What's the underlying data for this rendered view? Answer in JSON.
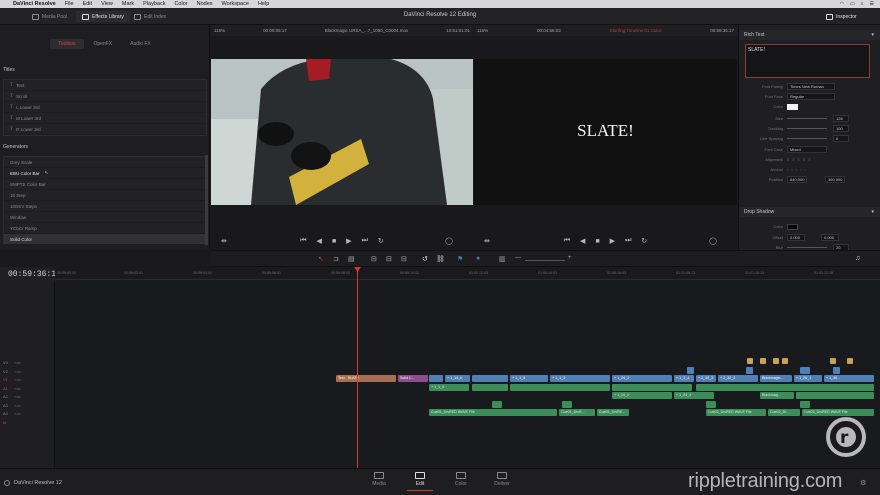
{
  "menubar": {
    "app": "DaVinci Resolve",
    "items": [
      "File",
      "Edit",
      "View",
      "Mark",
      "Playback",
      "Color",
      "Nodes",
      "Workspace",
      "Help"
    ]
  },
  "titlebar": {
    "media_pool": "Media Pool",
    "effects_library": "Effects Library",
    "edit_index": "Edit Index",
    "project": "DaVinci Resolve 12 Editing",
    "inspector": "Inspector"
  },
  "leftpanel": {
    "tabs": [
      "Toolbox",
      "OpenFX",
      "Audio FX"
    ],
    "titles_header": "Titles",
    "titles": [
      "Text",
      "Scroll",
      "L Lower 3rd",
      "M Lower 3rd",
      "R Lower 3rd"
    ],
    "generators_header": "Generators",
    "generators": [
      "Grey Scale",
      "EBU Color Bar",
      "SMPTE Color Bar",
      "10 Step",
      "100mV Steps",
      "Window",
      "YCbCr Ramp",
      "Solid Color"
    ]
  },
  "viewerL": {
    "zoom": "116%",
    "tc_in": "00:00:05:17",
    "clip": "Blackmagic URSA_...7_1050_C0004.mov",
    "tc_out": "10:51:01:01"
  },
  "viewerR": {
    "zoom": "116%",
    "tc_in": "00:04:56:03",
    "timeline": "Starting Timeline 01 Color",
    "tc_out": "00:59:36:17",
    "slate": "SLATE!"
  },
  "inspector": {
    "section1": "Rich Text",
    "text_value": "SLATE!",
    "font_family_label": "Font Family",
    "font_family": "Times New Roman",
    "font_face_label": "Font Face",
    "font_face": "Regular",
    "color_label": "Color",
    "size_label": "Size",
    "size": "128",
    "tracking_label": "Tracking",
    "tracking": "100",
    "line_spacing_label": "Line Spacing",
    "line_spacing": "0",
    "font_case_label": "Font Case",
    "font_case": "Mixed",
    "alignment_label": "Alignment",
    "anchor_label": "Anchor",
    "position_label": "Position",
    "pos_x": "640.000",
    "pos_y": "360.000",
    "section2": "Drop Shadow",
    "ds_color_label": "Color",
    "ds_offset_label": "Offset",
    "ds_x": "0.000",
    "ds_y": "0.000",
    "ds_blur_label": "Blur",
    "ds_blur": "20"
  },
  "timeline": {
    "timecode": "00:59:36:17",
    "ruler": [
      "00:59:00:00",
      "00:59:02:01",
      "00:59:04:01",
      "00:59:06:01",
      "00:59:08:02",
      "00:59:10:02",
      "01:00:12:03",
      "01:00:14:03",
      "01:00:16:03",
      "01:01:00:00",
      "01:01:08:13",
      "01:01:10:13",
      "01:01:12:15",
      "01:01:14:15"
    ],
    "tracks": [
      "V3",
      "V2",
      "V1",
      "A1",
      "A2",
      "A3",
      "A4",
      "M"
    ],
    "clips_v1": [
      "Text - SLATE",
      "Solid C...",
      "+ 1_14_b",
      "+ 1_1_5",
      "+ 1_1_3",
      "+ 1_24_2",
      "+ 1_3_4",
      "+ 2_30_3",
      "+ 2_32_3",
      "Blackmagic...",
      "+ 1_26_1",
      "+ 1_36..."
    ],
    "clips_a": [
      "+ 1_1_5",
      "+ 1_24_2",
      "+ 1_24_3",
      "Blackmag...",
      "Cue01_DrvRED WAVE File",
      "Cue01_DrvR...",
      "Cue01_DrvRE...",
      "Cue02_DrvRED WAVE File",
      "Cue02_Dr...",
      "Cue03_DrvRED WAVE File"
    ]
  },
  "pages": [
    "Media",
    "Edit",
    "Color",
    "Deliver"
  ],
  "bottom": {
    "version": "DaVinci Resolve 12",
    "brand": "rippletraining.com"
  }
}
